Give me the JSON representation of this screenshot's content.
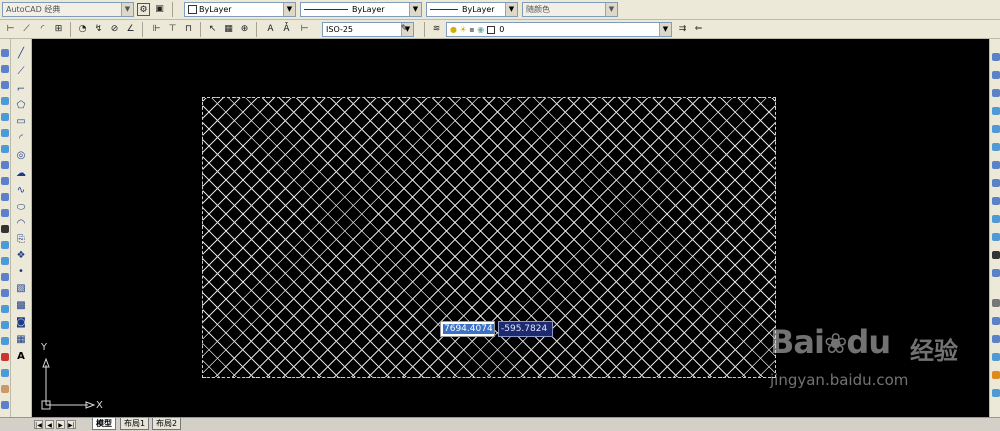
{
  "toolbar1": {
    "workspace": "AutoCAD 经典",
    "layer_color": "ByLayer",
    "linetype": "ByLayer",
    "lineweight": "ByLayer",
    "plot_style": "随颜色"
  },
  "toolbar2": {
    "dim_style": "ISO-25",
    "layer_name": "0"
  },
  "canvas": {
    "background": "#000000",
    "hatch_pattern": "ANSI37-crosshatch",
    "dynamic_input_x": "7694.4074",
    "dynamic_input_y": "-595.7824",
    "ucs_x_label": "X",
    "ucs_y_label": "Y"
  },
  "watermark": {
    "logo": "Bai",
    "logo_tail": "du",
    "cn": "经验",
    "url": "jingyan.baidu.com"
  },
  "tabs": {
    "model": "模型",
    "layout1": "布局1",
    "layout2": "布局2"
  },
  "icons": [
    "line-icon",
    "polyline-icon",
    "polygon-icon",
    "rectangle-icon",
    "arc-icon",
    "circle-icon",
    "revcloud-icon",
    "spline-icon",
    "ellipse-icon",
    "insert-block-icon",
    "point-icon",
    "hatch-icon",
    "table-icon",
    "text-icon"
  ]
}
